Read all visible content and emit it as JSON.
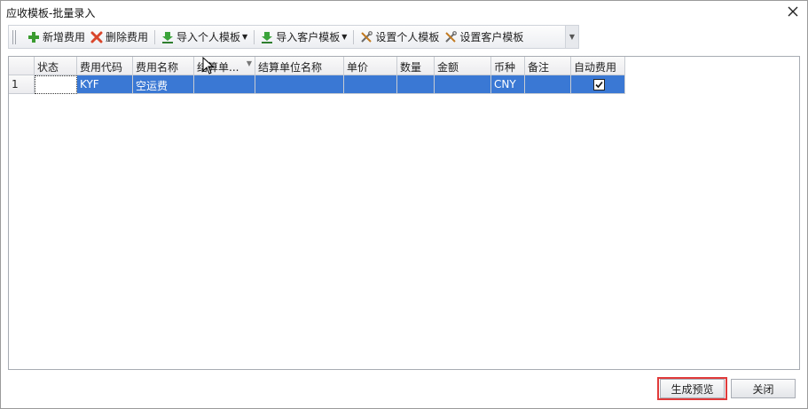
{
  "window": {
    "title": "应收模板-批量录入"
  },
  "toolbar": {
    "add_fee": "新增费用",
    "delete_fee": "删除费用",
    "import_personal": "导入个人模板",
    "import_customer": "导入客户模板",
    "set_personal": "设置个人模板",
    "set_customer": "设置客户模板"
  },
  "grid": {
    "columns": [
      "状态",
      "费用代码",
      "费用名称",
      "结算单...",
      "结算单位名称",
      "单价",
      "数量",
      "金额",
      "币种",
      "备注",
      "自动费用"
    ],
    "rows": [
      {
        "row_number": "1",
        "status": "",
        "fee_code": "KYF",
        "fee_name": "空运费",
        "settle_unit": "",
        "settle_unit_name": "",
        "unit_price": "",
        "quantity": "",
        "amount": "",
        "currency": "CNY",
        "remark": "",
        "auto_fee": true
      }
    ]
  },
  "footer": {
    "preview_label": "生成预览",
    "close_label": "关闭"
  },
  "colors": {
    "selection": "#3a78d4",
    "highlight": "#e03a3a"
  }
}
